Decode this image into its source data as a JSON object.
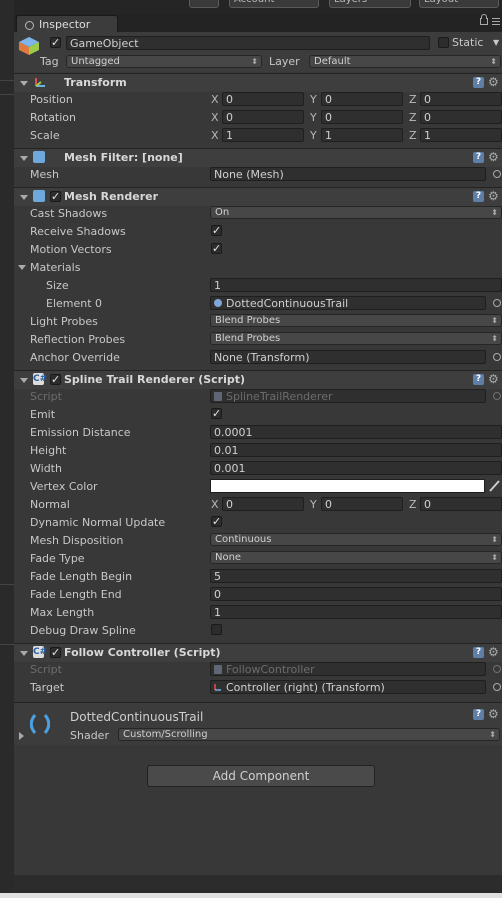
{
  "window": {
    "tab": "Inspector"
  },
  "topbar": {
    "account": "Account",
    "layers": "Layers",
    "layout": "Layout"
  },
  "gameobject": {
    "name": "GameObject",
    "static_label": "Static",
    "tag_label": "Tag",
    "tag_value": "Untagged",
    "layer_label": "Layer",
    "layer_value": "Default"
  },
  "transform": {
    "title": "Transform",
    "rows": [
      {
        "label": "Position",
        "x": "0",
        "y": "0",
        "z": "0"
      },
      {
        "label": "Rotation",
        "x": "0",
        "y": "0",
        "z": "0"
      },
      {
        "label": "Scale",
        "x": "1",
        "y": "1",
        "z": "1"
      }
    ],
    "axis": {
      "x": "X",
      "y": "Y",
      "z": "Z"
    }
  },
  "mesh_filter": {
    "title": "Mesh Filter: [none]",
    "mesh_label": "Mesh",
    "mesh_value": "None (Mesh)"
  },
  "mesh_renderer": {
    "title": "Mesh Renderer",
    "cast_shadows_label": "Cast Shadows",
    "cast_shadows_value": "On",
    "receive_shadows_label": "Receive Shadows",
    "receive_shadows": true,
    "motion_vectors_label": "Motion Vectors",
    "motion_vectors": true,
    "materials_label": "Materials",
    "size_label": "Size",
    "size_value": "1",
    "element0_label": "Element 0",
    "element0_value": "DottedContinuousTrail",
    "light_probes_label": "Light Probes",
    "light_probes_value": "Blend Probes",
    "reflection_probes_label": "Reflection Probes",
    "reflection_probes_value": "Blend Probes",
    "anchor_label": "Anchor Override",
    "anchor_value": "None (Transform)"
  },
  "spline": {
    "title": "Spline Trail Renderer (Script)",
    "script_label": "Script",
    "script_value": "SplineTrailRenderer",
    "emit_label": "Emit",
    "emit": true,
    "emission_distance_label": "Emission Distance",
    "emission_distance": "0.0001",
    "height_label": "Height",
    "height": "0.01",
    "width_label": "Width",
    "width": "0.001",
    "vertex_color_label": "Vertex Color",
    "vertex_color": "#ffffff",
    "normal_label": "Normal",
    "normal_x": "0",
    "normal_y": "0",
    "normal_z": "0",
    "dynamic_normal_label": "Dynamic Normal Update",
    "dynamic_normal": true,
    "mesh_disposition_label": "Mesh Disposition",
    "mesh_disposition": "Continuous",
    "fade_type_label": "Fade Type",
    "fade_type": "None",
    "fade_begin_label": "Fade Length Begin",
    "fade_begin": "5",
    "fade_end_label": "Fade Length End",
    "fade_end": "0",
    "max_length_label": "Max Length",
    "max_length": "1",
    "debug_draw_label": "Debug Draw Spline",
    "debug_draw": false
  },
  "follow": {
    "title": "Follow Controller (Script)",
    "script_label": "Script",
    "script_value": "FollowController",
    "target_label": "Target",
    "target_value": "Controller (right) (Transform)"
  },
  "material": {
    "name": "DottedContinuousTrail",
    "shader_label": "Shader",
    "shader_value": "Custom/Scrolling"
  },
  "add_component": "Add Component",
  "bottom_text": "...",
  "colors": {
    "panel": "#383838",
    "header": "#3e3e3e",
    "field": "#2f2f2f",
    "help": "#5f7fa8"
  },
  "checkmark": "✓",
  "arrow": "⬍",
  "gear": "⚙",
  "help": "?"
}
